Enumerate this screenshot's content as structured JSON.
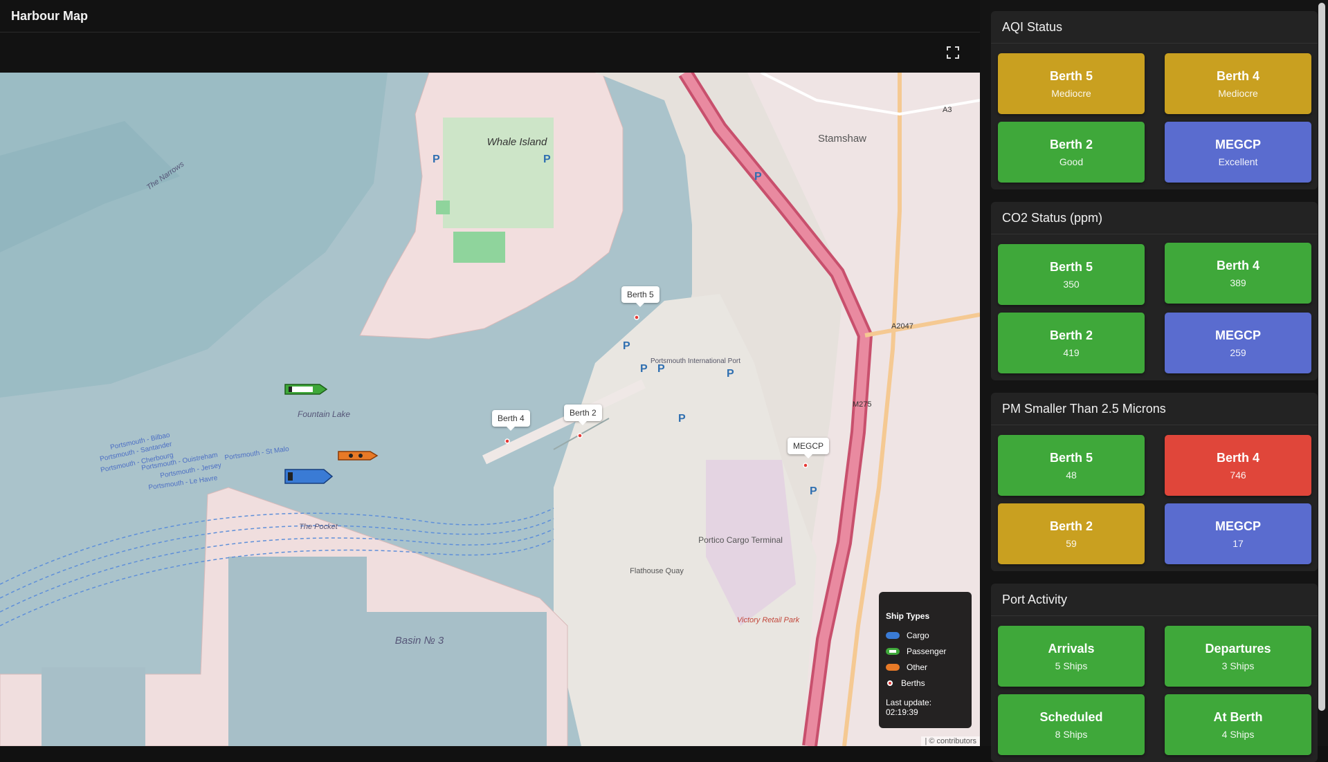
{
  "header": {
    "title": "Harbour Map"
  },
  "map": {
    "labels": {
      "whale_island": "Whale Island",
      "narrows": "The Narrows",
      "fountain_lake": "Fountain Lake",
      "stamshaw": "Stamshaw",
      "portico": "Portico Cargo Terminal",
      "basin3": "Basin № 3",
      "pocket": "The Pocket",
      "flathouse": "Flathouse Quay",
      "victory": "Victory Retail Park",
      "ferry_routes": [
        "Portsmouth - Bilbao",
        "Portsmouth - Santander",
        "Portsmouth - Cherbourg",
        "Portsmouth - Ouistreham",
        "Portsmouth - St Malo",
        "Portsmouth - Jersey",
        "Portsmouth - Le Havre"
      ],
      "a2047": "A2047",
      "m275": "M275",
      "a3": "A3",
      "intl_port": "Portsmouth International Port"
    },
    "berths": [
      {
        "label": "Berth 5"
      },
      {
        "label": "Berth 4"
      },
      {
        "label": "Berth 2"
      },
      {
        "label": "MEGCP"
      }
    ],
    "attribution": "| © contributors"
  },
  "legend": {
    "title": "Ship Types",
    "items": [
      {
        "label": "Cargo",
        "color": "#3a7bd5"
      },
      {
        "label": "Passenger",
        "color": "#3fa83a"
      },
      {
        "label": "Other",
        "color": "#e87a27"
      },
      {
        "label": "Berths",
        "color": "#e53935"
      }
    ],
    "last_update": "Last update: 02:19:39"
  },
  "panels": [
    {
      "title": "AQI Status",
      "tiles": [
        {
          "name": "Berth 5",
          "value": "Mediocre",
          "color": "#c9a020"
        },
        {
          "name": "Berth 4",
          "value": "Mediocre",
          "color": "#c9a020"
        },
        {
          "name": "Berth 2",
          "value": "Good",
          "color": "#3fa83a"
        },
        {
          "name": "MEGCP",
          "value": "Excellent",
          "color": "#5a6ccf"
        }
      ]
    },
    {
      "title": "CO2 Status (ppm)",
      "tiles": [
        {
          "name": "Berth 5",
          "value": "350",
          "color": "#3fa83a"
        },
        {
          "name": "Berth 4",
          "value": "389",
          "color": "#3fa83a"
        },
        {
          "name": "Berth 2",
          "value": "419",
          "color": "#3fa83a"
        },
        {
          "name": "MEGCP",
          "value": "259",
          "color": "#5a6ccf"
        }
      ]
    },
    {
      "title": "PM Smaller Than 2.5 Microns",
      "tiles": [
        {
          "name": "Berth 5",
          "value": "48",
          "color": "#3fa83a"
        },
        {
          "name": "Berth 4",
          "value": "746",
          "color": "#e0463a"
        },
        {
          "name": "Berth 2",
          "value": "59",
          "color": "#c9a020"
        },
        {
          "name": "MEGCP",
          "value": "17",
          "color": "#5a6ccf"
        }
      ]
    },
    {
      "title": "Port Activity",
      "tiles": [
        {
          "name": "Arrivals",
          "value": "5 Ships",
          "color": "#3fa83a"
        },
        {
          "name": "Departures",
          "value": "3 Ships",
          "color": "#3fa83a"
        },
        {
          "name": "Scheduled",
          "value": "8 Ships",
          "color": "#3fa83a"
        },
        {
          "name": "At Berth",
          "value": "4 Ships",
          "color": "#3fa83a"
        }
      ]
    }
  ]
}
